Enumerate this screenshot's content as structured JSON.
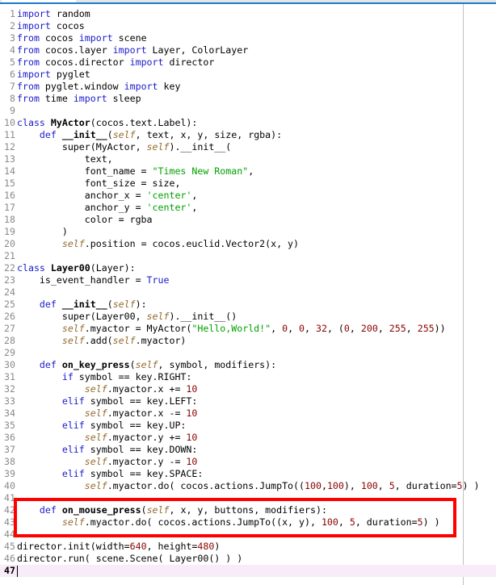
{
  "editor": {
    "current_line": 47,
    "highlight_color": "#ff0000",
    "highlight_lines": [
      42,
      43,
      44
    ],
    "lines": [
      [
        [
          "k",
          "import"
        ],
        [
          "p",
          " random"
        ]
      ],
      [
        [
          "k",
          "import"
        ],
        [
          "p",
          " cocos"
        ]
      ],
      [
        [
          "k",
          "from"
        ],
        [
          "p",
          " cocos "
        ],
        [
          "k",
          "import"
        ],
        [
          "p",
          " scene"
        ]
      ],
      [
        [
          "k",
          "from"
        ],
        [
          "p",
          " cocos.layer "
        ],
        [
          "k",
          "import"
        ],
        [
          "p",
          " Layer, ColorLayer"
        ]
      ],
      [
        [
          "k",
          "from"
        ],
        [
          "p",
          " cocos.director "
        ],
        [
          "k",
          "import"
        ],
        [
          "p",
          " director"
        ]
      ],
      [
        [
          "k",
          "import"
        ],
        [
          "p",
          " pyglet"
        ]
      ],
      [
        [
          "k",
          "from"
        ],
        [
          "p",
          " pyglet.window "
        ],
        [
          "k",
          "import"
        ],
        [
          "p",
          " key"
        ]
      ],
      [
        [
          "k",
          "from"
        ],
        [
          "p",
          " time "
        ],
        [
          "k",
          "import"
        ],
        [
          "p",
          " sleep"
        ]
      ],
      [],
      [
        [
          "k",
          "class"
        ],
        [
          "p",
          " "
        ],
        [
          "b",
          "MyActor"
        ],
        [
          "p",
          "(cocos.text.Label):"
        ]
      ],
      [
        [
          "p",
          "    "
        ],
        [
          "k",
          "def"
        ],
        [
          "p",
          " "
        ],
        [
          "b",
          "__init__"
        ],
        [
          "p",
          "("
        ],
        [
          "s",
          "self"
        ],
        [
          "p",
          ", text, x, y, size, rgba):"
        ]
      ],
      [
        [
          "p",
          "        super(MyActor, "
        ],
        [
          "s",
          "self"
        ],
        [
          "p",
          ").__init__("
        ]
      ],
      [
        [
          "p",
          "            text,"
        ]
      ],
      [
        [
          "p",
          "            font_name = "
        ],
        [
          "q",
          "\"Times New Roman\""
        ],
        [
          "p",
          ","
        ]
      ],
      [
        [
          "p",
          "            font_size = size,"
        ]
      ],
      [
        [
          "p",
          "            anchor_x = "
        ],
        [
          "q",
          "'center'"
        ],
        [
          "p",
          ","
        ]
      ],
      [
        [
          "p",
          "            anchor_y = "
        ],
        [
          "q",
          "'center'"
        ],
        [
          "p",
          ","
        ]
      ],
      [
        [
          "p",
          "            color = rgba"
        ]
      ],
      [
        [
          "p",
          "        )"
        ]
      ],
      [
        [
          "p",
          "        "
        ],
        [
          "s",
          "self"
        ],
        [
          "p",
          ".position = cocos.euclid.Vector2(x, y)"
        ]
      ],
      [],
      [
        [
          "k",
          "class"
        ],
        [
          "p",
          " "
        ],
        [
          "b",
          "Layer00"
        ],
        [
          "p",
          "(Layer):"
        ]
      ],
      [
        [
          "p",
          "    is_event_handler = "
        ],
        [
          "k",
          "True"
        ]
      ],
      [],
      [
        [
          "p",
          "    "
        ],
        [
          "k",
          "def"
        ],
        [
          "p",
          " "
        ],
        [
          "b",
          "__init__"
        ],
        [
          "p",
          "("
        ],
        [
          "s",
          "self"
        ],
        [
          "p",
          "):"
        ]
      ],
      [
        [
          "p",
          "        super(Layer00, "
        ],
        [
          "s",
          "self"
        ],
        [
          "p",
          ").__init__()"
        ]
      ],
      [
        [
          "p",
          "        "
        ],
        [
          "s",
          "self"
        ],
        [
          "p",
          ".myactor = MyActor("
        ],
        [
          "q",
          "\"Hello,World!\""
        ],
        [
          "p",
          ", "
        ],
        [
          "n",
          "0"
        ],
        [
          "p",
          ", "
        ],
        [
          "n",
          "0"
        ],
        [
          "p",
          ", "
        ],
        [
          "n",
          "32"
        ],
        [
          "p",
          ", ("
        ],
        [
          "n",
          "0"
        ],
        [
          "p",
          ", "
        ],
        [
          "n",
          "200"
        ],
        [
          "p",
          ", "
        ],
        [
          "n",
          "255"
        ],
        [
          "p",
          ", "
        ],
        [
          "n",
          "255"
        ],
        [
          "p",
          "))"
        ]
      ],
      [
        [
          "p",
          "        "
        ],
        [
          "s",
          "self"
        ],
        [
          "p",
          ".add("
        ],
        [
          "s",
          "self"
        ],
        [
          "p",
          ".myactor)"
        ]
      ],
      [],
      [
        [
          "p",
          "    "
        ],
        [
          "k",
          "def"
        ],
        [
          "p",
          " "
        ],
        [
          "b",
          "on_key_press"
        ],
        [
          "p",
          "("
        ],
        [
          "s",
          "self"
        ],
        [
          "p",
          ", symbol, modifiers):"
        ]
      ],
      [
        [
          "p",
          "        "
        ],
        [
          "k",
          "if"
        ],
        [
          "p",
          " symbol == key.RIGHT:"
        ]
      ],
      [
        [
          "p",
          "            "
        ],
        [
          "s",
          "self"
        ],
        [
          "p",
          ".myactor.x += "
        ],
        [
          "n",
          "10"
        ]
      ],
      [
        [
          "p",
          "        "
        ],
        [
          "k",
          "elif"
        ],
        [
          "p",
          " symbol == key.LEFT:"
        ]
      ],
      [
        [
          "p",
          "            "
        ],
        [
          "s",
          "self"
        ],
        [
          "p",
          ".myactor.x -= "
        ],
        [
          "n",
          "10"
        ]
      ],
      [
        [
          "p",
          "        "
        ],
        [
          "k",
          "elif"
        ],
        [
          "p",
          " symbol == key.UP:"
        ]
      ],
      [
        [
          "p",
          "            "
        ],
        [
          "s",
          "self"
        ],
        [
          "p",
          ".myactor.y += "
        ],
        [
          "n",
          "10"
        ]
      ],
      [
        [
          "p",
          "        "
        ],
        [
          "k",
          "elif"
        ],
        [
          "p",
          " symbol == key.DOWN:"
        ]
      ],
      [
        [
          "p",
          "            "
        ],
        [
          "s",
          "self"
        ],
        [
          "p",
          ".myactor.y -= "
        ],
        [
          "n",
          "10"
        ]
      ],
      [
        [
          "p",
          "        "
        ],
        [
          "k",
          "elif"
        ],
        [
          "p",
          " symbol == key.SPACE:"
        ]
      ],
      [
        [
          "p",
          "            "
        ],
        [
          "s",
          "self"
        ],
        [
          "p",
          ".myactor.do( cocos.actions.JumpTo(("
        ],
        [
          "n",
          "100"
        ],
        [
          "p",
          ","
        ],
        [
          "n",
          "100"
        ],
        [
          "p",
          "), "
        ],
        [
          "n",
          "100"
        ],
        [
          "p",
          ", "
        ],
        [
          "n",
          "5"
        ],
        [
          "p",
          ", duration="
        ],
        [
          "n",
          "5"
        ],
        [
          "p",
          ") )"
        ]
      ],
      [],
      [
        [
          "p",
          "    "
        ],
        [
          "k",
          "def"
        ],
        [
          "p",
          " "
        ],
        [
          "b",
          "on_mouse_press"
        ],
        [
          "p",
          "("
        ],
        [
          "s",
          "self"
        ],
        [
          "p",
          ", x, y, buttons, modifiers):"
        ]
      ],
      [
        [
          "p",
          "        "
        ],
        [
          "s",
          "self"
        ],
        [
          "p",
          ".myactor.do( cocos.actions.JumpTo((x, y), "
        ],
        [
          "n",
          "100"
        ],
        [
          "p",
          ", "
        ],
        [
          "n",
          "5"
        ],
        [
          "p",
          ", duration="
        ],
        [
          "n",
          "5"
        ],
        [
          "p",
          ") )"
        ]
      ],
      [],
      [
        [
          "p",
          "director.init(width="
        ],
        [
          "n",
          "640"
        ],
        [
          "p",
          ", height="
        ],
        [
          "n",
          "480"
        ],
        [
          "p",
          ")"
        ]
      ],
      [
        [
          "p",
          "director.run( scene.Scene( Layer00() ) )"
        ]
      ],
      []
    ]
  }
}
